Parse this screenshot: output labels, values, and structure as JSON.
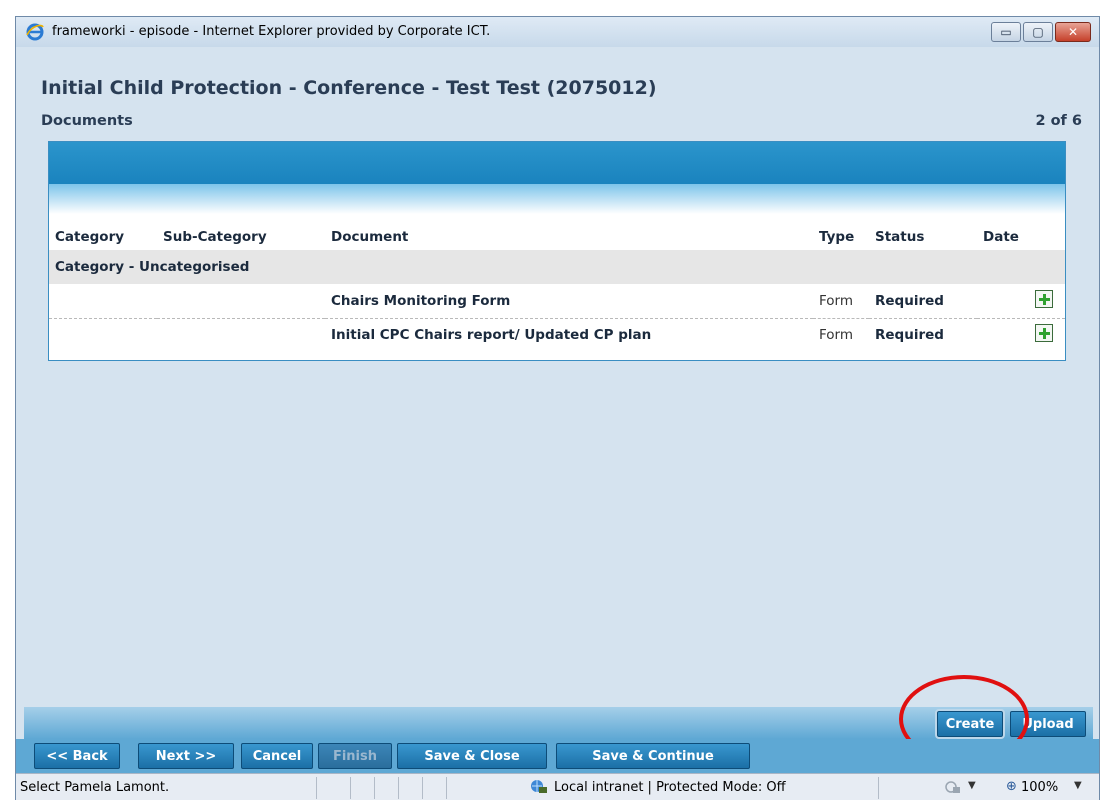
{
  "window": {
    "title": "frameworki - episode - Internet Explorer provided by Corporate ICT.",
    "minimize_glyph": "▭",
    "maximize_glyph": "▢",
    "close_glyph": "✕"
  },
  "page": {
    "title": "Initial Child Protection - Conference - Test Test (2075012)",
    "section": "Documents",
    "page_count": "2 of 6"
  },
  "table": {
    "headers": {
      "category": "Category",
      "sub_category": "Sub-Category",
      "document": "Document",
      "type": "Type",
      "status": "Status",
      "date": "Date"
    },
    "category_label": "Category - Uncategorised",
    "rows": [
      {
        "category": "",
        "sub_category": "",
        "document": "Chairs Monitoring Form",
        "type": "Form",
        "status": "Required",
        "date": "",
        "action_icon": "add-document-icon"
      },
      {
        "category": "",
        "sub_category": "",
        "document": "Initial CPC Chairs report/ Updated CP plan",
        "type": "Form",
        "status": "Required",
        "date": "",
        "action_icon": "add-document-icon"
      }
    ]
  },
  "buttons": {
    "create": "Create",
    "upload": "Upload",
    "back": "<< Back",
    "next": "Next >>",
    "cancel": "Cancel",
    "finish": "Finish",
    "save_close": "Save & Close",
    "save_continue": "Save & Continue"
  },
  "statusbar": {
    "message": "Select Pamela Lamont.",
    "zone": "Local intranet | Protected Mode: Off",
    "zoom": "100%"
  },
  "colors": {
    "panel_band": "#1a83be",
    "button": "#1b6fa6",
    "annotation": "#e01010",
    "title_text": "#2a3d55"
  }
}
